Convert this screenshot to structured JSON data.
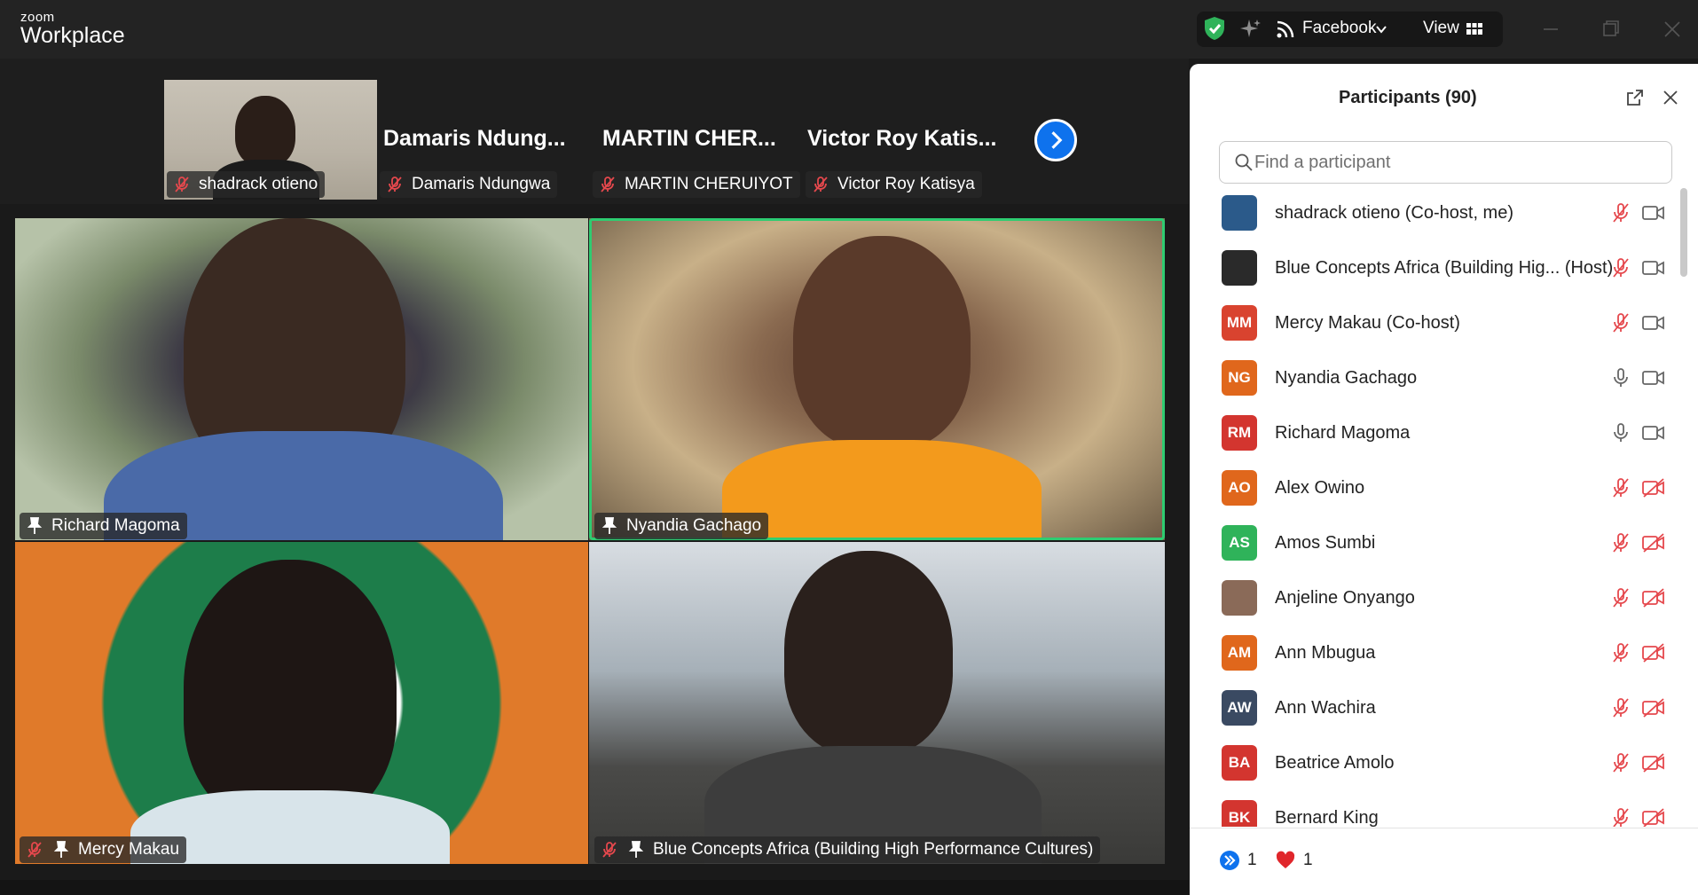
{
  "app": {
    "brand_small": "zoom",
    "brand_big": "Workplace"
  },
  "titlebar": {
    "stream_label": "Facebook",
    "view_label": "View"
  },
  "strip": {
    "tiles": [
      {
        "name": "shadrack otieno",
        "label": "shadrack otieno"
      },
      {
        "name": "Damaris  Ndung...",
        "label": "Damaris Ndungwa"
      },
      {
        "name": "MARTIN  CHER...",
        "label": "MARTIN CHERUIYOT"
      },
      {
        "name": "Victor  Roy  Katis...",
        "label": "Victor Roy Katisya"
      }
    ]
  },
  "gallery": [
    {
      "label": "Richard Magoma"
    },
    {
      "label": "Nyandia Gachago"
    },
    {
      "label": "Mercy Makau"
    },
    {
      "label": "Blue Concepts Africa (Building High Performance Cultures)"
    }
  ],
  "participants": {
    "title": "Participants (90)",
    "search_placeholder": "Find a participant",
    "list": [
      {
        "name": "shadrack otieno (Co-host, me)",
        "initials": "",
        "color": "#2b5a8a",
        "mic": "muted",
        "cam": "on"
      },
      {
        "name": "Blue Concepts Africa (Building Hig...  (Host)",
        "initials": "",
        "color": "#2a2a2a",
        "mic": "muted",
        "cam": "on"
      },
      {
        "name": "Mercy Makau (Co-host)",
        "initials": "MM",
        "color": "#d9432f",
        "mic": "muted",
        "cam": "on"
      },
      {
        "name": "Nyandia Gachago",
        "initials": "NG",
        "color": "#e0671c",
        "mic": "on",
        "cam": "on"
      },
      {
        "name": "Richard Magoma",
        "initials": "RM",
        "color": "#d3352f",
        "mic": "on",
        "cam": "on"
      },
      {
        "name": "Alex Owino",
        "initials": "AO",
        "color": "#e0671c",
        "mic": "muted",
        "cam": "off"
      },
      {
        "name": "Amos Sumbi",
        "initials": "AS",
        "color": "#2fb35a",
        "mic": "muted",
        "cam": "off"
      },
      {
        "name": "Anjeline Onyango",
        "initials": "",
        "color": "#8a6a58",
        "mic": "muted",
        "cam": "off"
      },
      {
        "name": "Ann Mbugua",
        "initials": "AM",
        "color": "#e0671c",
        "mic": "muted",
        "cam": "off"
      },
      {
        "name": "Ann Wachira",
        "initials": "AW",
        "color": "#3a4a62",
        "mic": "muted",
        "cam": "off"
      },
      {
        "name": "Beatrice Amolo",
        "initials": "BA",
        "color": "#d3352f",
        "mic": "muted",
        "cam": "off"
      },
      {
        "name": "Bernard King",
        "initials": "BK",
        "color": "#d3352f",
        "mic": "muted",
        "cam": "off"
      }
    ]
  },
  "footer": {
    "raise_count": "1",
    "heart_count": "1"
  }
}
